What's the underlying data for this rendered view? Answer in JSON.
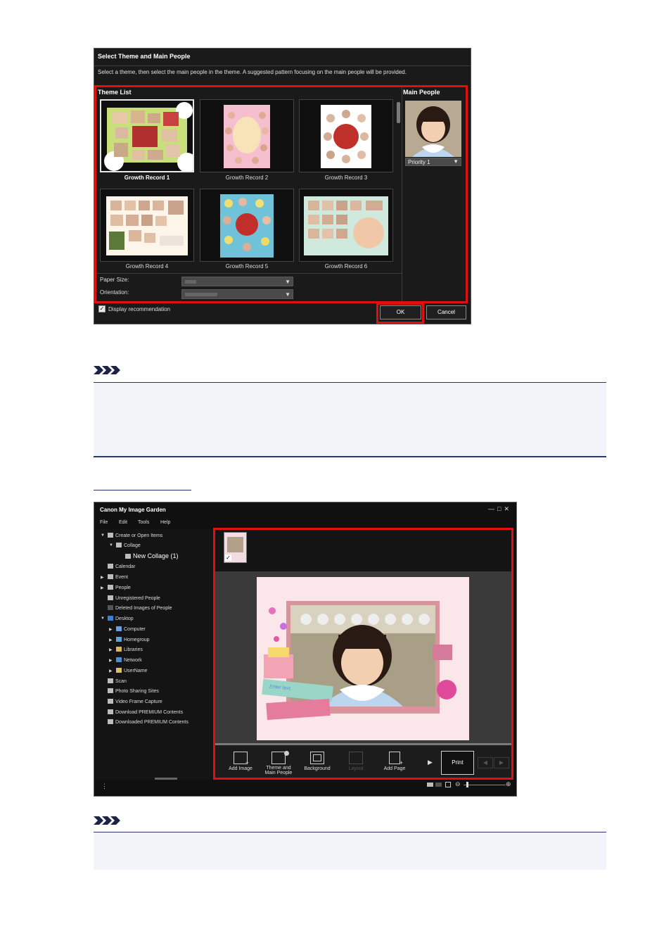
{
  "dialog": {
    "title": "Select Theme and Main People",
    "instruction": "Select a theme, then select the main people in the theme. A suggested pattern focusing on the main people will be provided.",
    "theme_list_label": "Theme List",
    "main_people_label": "Main People",
    "themes": [
      {
        "label": "Growth Record 1",
        "selected": true
      },
      {
        "label": "Growth Record 2",
        "selected": false
      },
      {
        "label": "Growth Record 3",
        "selected": false
      },
      {
        "label": "Growth Record 4",
        "selected": false
      },
      {
        "label": "Growth Record 5",
        "selected": false
      },
      {
        "label": "Growth Record 6",
        "selected": false
      }
    ],
    "priority_value": "Priority 1",
    "paper_size_label": "Paper Size:",
    "orientation_label": "Orientation:",
    "display_recommendation_label": "Display recommendation",
    "display_recommendation_checked": true,
    "ok_label": "OK",
    "cancel_label": "Cancel"
  },
  "app": {
    "title": "Canon My Image Garden",
    "window_controls": [
      "—",
      "□",
      "✕"
    ],
    "menu": [
      "File",
      "Edit",
      "Tools",
      "Help"
    ],
    "tree": [
      {
        "label": "Create or Open Items"
      },
      {
        "label": "Collage"
      },
      {
        "label": "New Collage (1)"
      },
      {
        "label": "Calendar"
      },
      {
        "label": "Event"
      },
      {
        "label": "People"
      },
      {
        "label": "Unregistered People"
      },
      {
        "label": "Deleted Images of People"
      },
      {
        "label": "Desktop"
      },
      {
        "label": "Computer"
      },
      {
        "label": "Homegroup"
      },
      {
        "label": "Libraries"
      },
      {
        "label": "Network"
      },
      {
        "label": "UserName"
      },
      {
        "label": "Scan"
      },
      {
        "label": "Photo Sharing Sites"
      },
      {
        "label": "Video Frame Capture"
      },
      {
        "label": "Download PREMIUM Contents"
      },
      {
        "label": "Downloaded PREMIUM Contents"
      }
    ],
    "toolbar": {
      "add_image": "Add Image",
      "theme_main_people": "Theme and Main People",
      "background": "Background",
      "layout": "Layout",
      "add_page": "Add Page",
      "print": "Print"
    },
    "canvas_text": "Enter text."
  },
  "colors": {
    "highlight_red": "#e01010",
    "note_border": "#2a3570",
    "note_bg": "#f3f4f9",
    "link_underline": "#2a3570"
  }
}
